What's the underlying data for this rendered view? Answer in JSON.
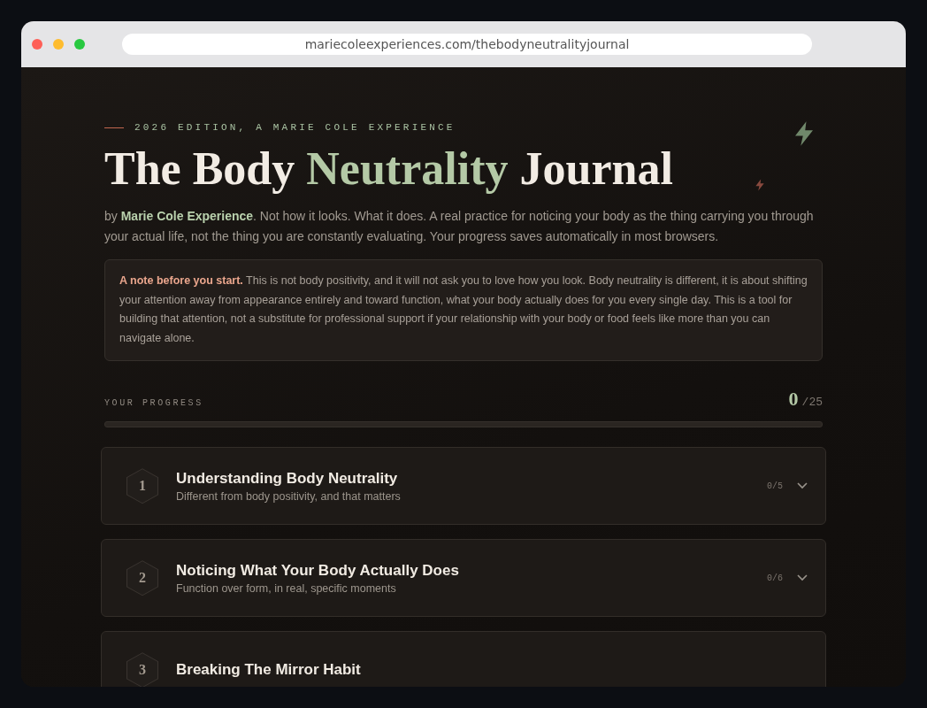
{
  "browser": {
    "url": "mariecoleexperiences.com/thebodyneutralityjournal"
  },
  "eyebrow": "2026 EDITION, A MARIE COLE EXPERIENCE",
  "title": {
    "before": "The Body ",
    "accent": "Neutrality",
    "after": " Journal"
  },
  "intro": "by **Marie Cole Experience**. Not how it looks. What it does. A real practice for noticing your body as the thing carrying you through your actual life, not the thing you are constantly evaluating. Your progress saves automatically in most browsers.",
  "note": "**A note before you start.** This is not body positivity, and it will not ask you to love how you look. Body neutrality is different, it is about shifting your attention away from appearance entirely and toward function, what your body actually does for you every single day. This is a tool for building that attention, not a substitute for professional support if your relationship with your body or food feels like more than you can navigate alone.",
  "progress": {
    "label": "YOUR PROGRESS",
    "count": "0",
    "total": "/25",
    "level": 0
  },
  "sections": [
    {
      "number": "1",
      "title": "Understanding Body Neutrality",
      "subtitle": "Different from body positivity, and that matters",
      "count": "0/5",
      "expanded": false
    },
    {
      "number": "2",
      "title": "Noticing What Your Body Actually Does",
      "subtitle": "Function over form, in real, specific moments",
      "count": "0/6",
      "expanded": false
    },
    {
      "number": "3",
      "title": "Breaking The Mirror Habit",
      "expanded": false
    }
  ]
}
